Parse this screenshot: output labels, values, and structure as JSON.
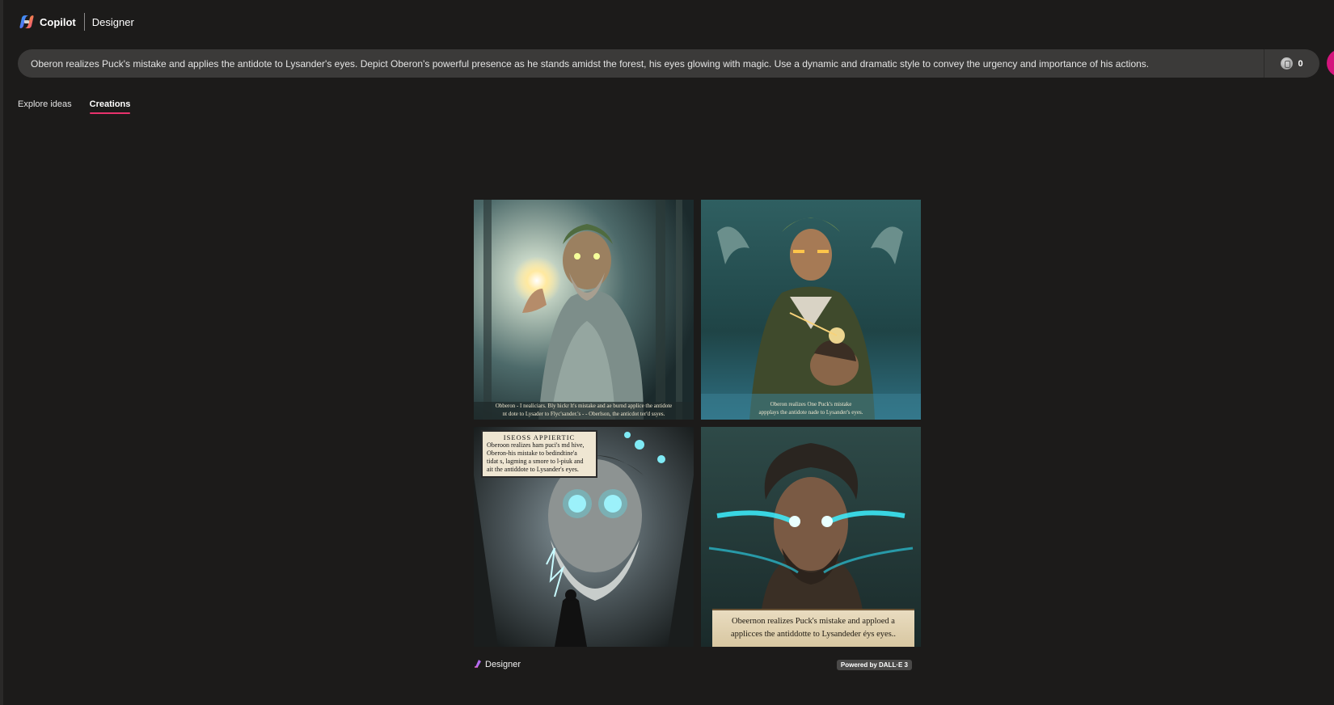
{
  "header": {
    "brand": "Copilot",
    "product": "Designer"
  },
  "prompt": {
    "text": "Oberon realizes Puck's mistake and applies the antidote to Lysander's eyes. Depict Oberon's powerful presence as he stands amidst the forest, his eyes glowing with magic. Use a dynamic and dramatic style to convey the urgency and importance of his actions.",
    "boosts": "0"
  },
  "tabs": [
    {
      "label": "Explore ideas",
      "active": false
    },
    {
      "label": "Creations",
      "active": true
    }
  ],
  "images": [
    {
      "caption_lines": [
        "Obberon - I nealiciars. Bly hickr lt's mistake and ae burnd applice the antidote",
        "nt dote to Lysader to Flyc'sander.'s - -  Oberlson, the anticdot ter'd ssyes."
      ]
    },
    {
      "caption_lines": [
        "Oberon realizes One Puck's mistake",
        "appplays the antidote nade to Lysander's eyes."
      ]
    },
    {
      "title": "ISEOSS APPIERTIC",
      "caption_lines": [
        "Oberoon realizes ham puci's md hive,",
        "Oberon-his mistake to bedindtine'a",
        "tidat s, lagming a smore to l-piuk and",
        "ait the antiddote to Lysander's eyes."
      ]
    },
    {
      "caption_lines": [
        "Obeernon realizes Puck's mistake and apploed a",
        "applicces the antiddotte to Lysandeder éys eyes.."
      ]
    }
  ],
  "footer": {
    "brand": "Designer",
    "powered_by": "Powered by DALL·E 3"
  },
  "colors": {
    "background": "#1c1b1a",
    "prompt_bar": "#3b3a39",
    "accent_tab": "#e8326d",
    "create_button": "#d4157d"
  },
  "icons": {
    "logo": "copilot-logo-icon",
    "boost": "coin-icon",
    "footer": "designer-logo-icon"
  }
}
